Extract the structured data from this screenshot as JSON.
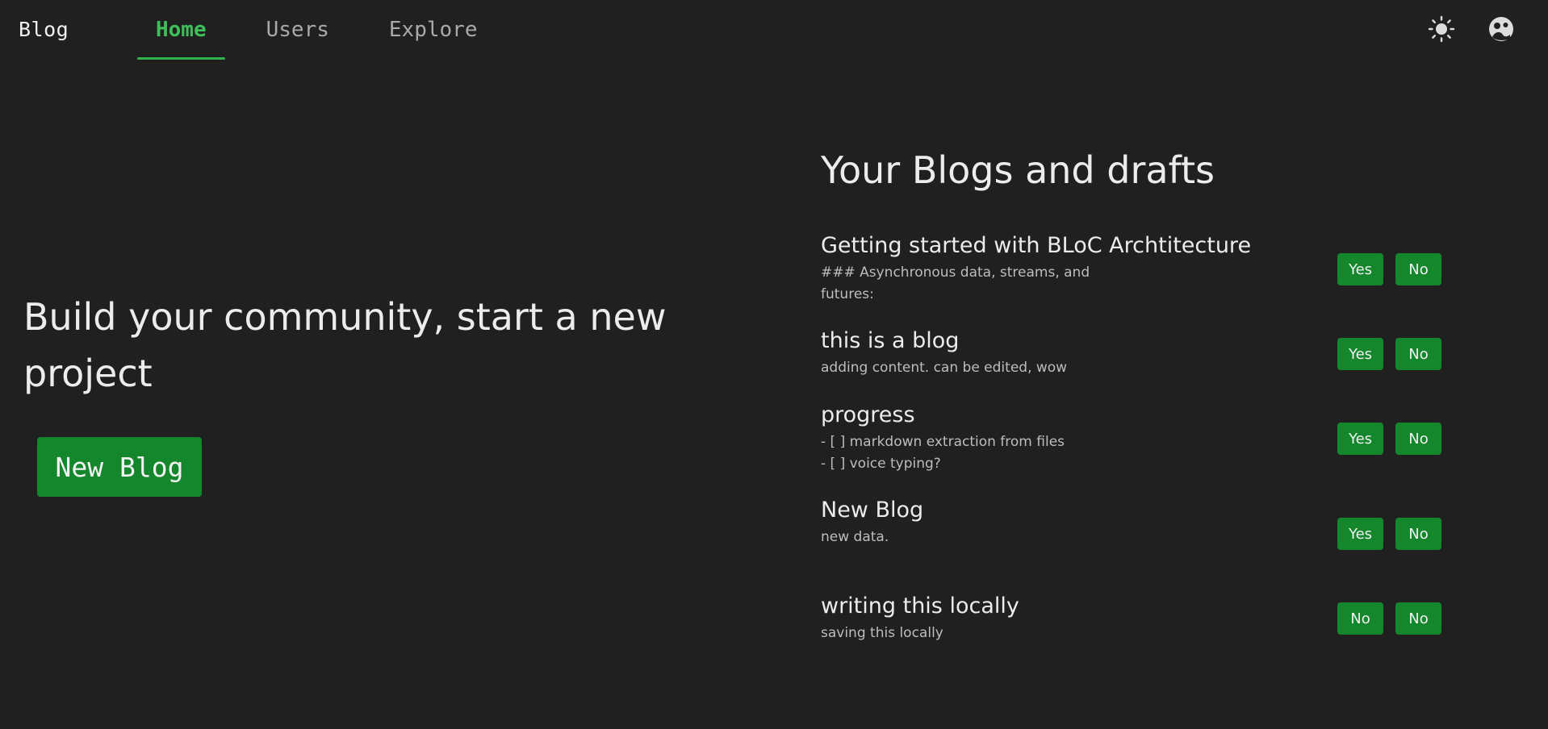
{
  "nav": {
    "brand": "Blog",
    "tabs": [
      {
        "label": "Home",
        "active": true
      },
      {
        "label": "Users",
        "active": false
      },
      {
        "label": "Explore",
        "active": false
      }
    ],
    "icons": [
      "sun-icon",
      "avatar-icon"
    ]
  },
  "hero": {
    "title": "Build your community, start a new project",
    "button_label": "New Blog"
  },
  "blogs": {
    "title": "Your Blogs and drafts",
    "items": [
      {
        "name": "Getting started with BLoC Archtitecture",
        "snippet": "### Asynchronous data, streams, and futures:",
        "btn1": "Yes",
        "btn2": "No"
      },
      {
        "name": "this is a blog",
        "snippet": "adding content. can be edited, wow",
        "btn1": "Yes",
        "btn2": "No"
      },
      {
        "name": "progress",
        "snippet": "- [ ] markdown extraction from files\n- [ ] voice typing?",
        "btn1": "Yes",
        "btn2": "No"
      },
      {
        "name": "New Blog",
        "snippet": "new data.",
        "btn1": "Yes",
        "btn2": "No"
      },
      {
        "name": "writing this locally",
        "snippet": "saving this locally",
        "btn1": "No",
        "btn2": "No"
      }
    ]
  },
  "colors": {
    "background": "#202020",
    "accent_green": "#14872c",
    "active_tab": "#3fbf5a"
  }
}
